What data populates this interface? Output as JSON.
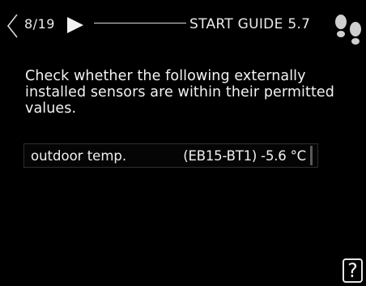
{
  "header": {
    "page_counter": "8/19",
    "title": "START GUIDE 5.7",
    "back_icon": "chevron-left-icon",
    "forward_icon": "play-arrow-icon",
    "guide_icon": "footsteps-icon"
  },
  "main": {
    "instruction": "Check whether the following externally installed sensors are within their permitted values.",
    "sensors": [
      {
        "label": "outdoor temp.",
        "value": "(EB15-BT1) -5.6 °C"
      }
    ]
  },
  "footer": {
    "help_label": "?"
  },
  "colors": {
    "background": "#000000",
    "text": "#f2f2f2"
  }
}
